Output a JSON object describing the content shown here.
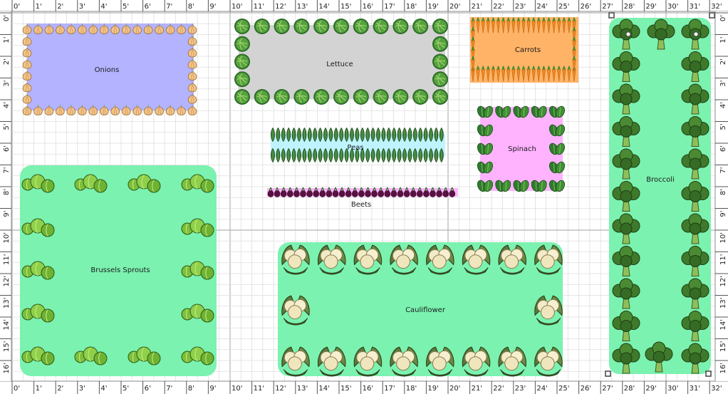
{
  "ruler": {
    "top_labels": [
      "0'",
      "1'",
      "2'",
      "3'",
      "4'",
      "5'",
      "6'",
      "7'",
      "8'",
      "9'",
      "10'",
      "11'",
      "12'",
      "13'",
      "14'",
      "15'",
      "16'",
      "17'",
      "18'",
      "19'",
      "20'",
      "21'",
      "22'",
      "23'",
      "24'",
      "25'",
      "26'",
      "27'",
      "28'",
      "29'",
      "30'",
      "31'",
      "32'"
    ],
    "left_labels": [
      "0'",
      "1'",
      "2'",
      "3'",
      "4'",
      "5'",
      "6'",
      "7'",
      "8'",
      "9'",
      "10'",
      "11'",
      "12'",
      "13'",
      "14'",
      "15'",
      "16'"
    ],
    "right_labels": [
      "0'",
      "1'",
      "2'",
      "3'",
      "4'",
      "5'",
      "6'",
      "7'",
      "8'",
      "9'",
      "10'",
      "11'",
      "12'",
      "13'",
      "14'",
      "15'",
      "16'"
    ]
  },
  "beds": {
    "onions": "Onions",
    "lettuce": "Lettuce",
    "carrots": "Carrots",
    "peas": "Peas",
    "spinach": "Spinach",
    "beets": "Beets",
    "brussels": "Brussels Sprouts",
    "cauliflower": "Cauliflower",
    "broccoli": "Broccoli"
  },
  "colors": {
    "onions_fill": "#b3b3ff",
    "lettuce_fill": "#d3d3d3",
    "carrots_fill": "#ffb366",
    "peas_fill": "#bff4ff",
    "spinach_fill": "#ffb3ff",
    "beets_fill": "#ffb3ff",
    "brussels_fill": "#7bf2b0",
    "cauliflower_fill": "#7bf2b0",
    "broccoli_fill": "#7bf2b0",
    "grid_minor": "#dedede",
    "grid_major": "#b4b4b4"
  },
  "icons": {
    "onion": "onion-icon",
    "lettuce": "lettuce-icon",
    "carrot": "carrot-icon",
    "pea": "pea-pod-icon",
    "spinach": "spinach-icon",
    "beet": "beet-icon",
    "brussels": "brussels-sprout-icon",
    "cauliflower": "cauliflower-icon",
    "broccoli": "broccoli-icon",
    "handle": "resize-handle-icon"
  }
}
